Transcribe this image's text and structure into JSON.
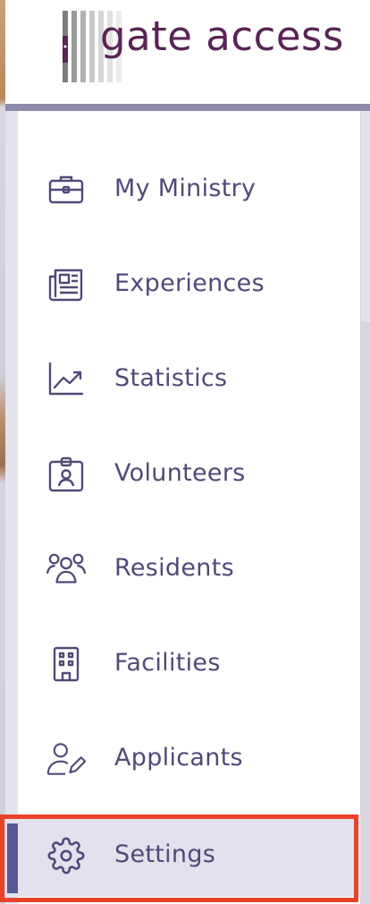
{
  "logo": {
    "text": "gate access",
    "bar_colors": [
      "#7e7e7e",
      "#9a9a9a",
      "#b2b2b2",
      "#c8c8c8",
      "#dadada"
    ],
    "text_color": "#5a2456"
  },
  "accent": {
    "menu_text": "#4e4b78",
    "active_background": "#e2e1ec",
    "active_bar": "#5a5798",
    "header_bar": "#8e8aab",
    "highlight_border": "#e8432a"
  },
  "menu": {
    "items": [
      {
        "label": "My Ministry",
        "icon": "briefcase-icon"
      },
      {
        "label": "Experiences",
        "icon": "newspaper-icon"
      },
      {
        "label": "Statistics",
        "icon": "chart-line-icon"
      },
      {
        "label": "Volunteers",
        "icon": "id-badge-icon"
      },
      {
        "label": "Residents",
        "icon": "users-icon"
      },
      {
        "label": "Facilities",
        "icon": "building-icon"
      },
      {
        "label": "Applicants",
        "icon": "user-edit-icon"
      },
      {
        "label": "Settings",
        "icon": "gear-icon",
        "active": true
      }
    ]
  }
}
